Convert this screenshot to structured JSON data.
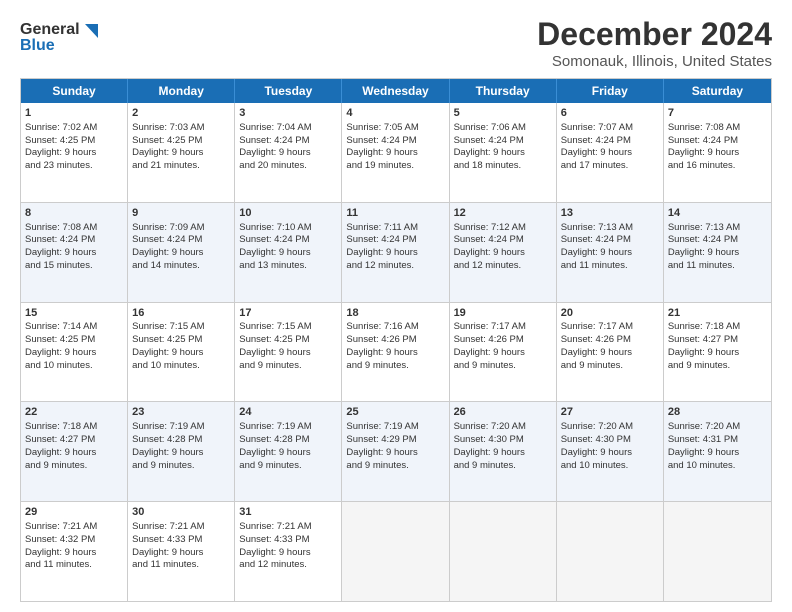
{
  "header": {
    "logo_general": "General",
    "logo_blue": "Blue",
    "title": "December 2024",
    "subtitle": "Somonauk, Illinois, United States"
  },
  "days_of_week": [
    "Sunday",
    "Monday",
    "Tuesday",
    "Wednesday",
    "Thursday",
    "Friday",
    "Saturday"
  ],
  "weeks": [
    [
      {
        "day": 1,
        "lines": [
          "Sunrise: 7:02 AM",
          "Sunset: 4:25 PM",
          "Daylight: 9 hours",
          "and 23 minutes."
        ],
        "shaded": false
      },
      {
        "day": 2,
        "lines": [
          "Sunrise: 7:03 AM",
          "Sunset: 4:25 PM",
          "Daylight: 9 hours",
          "and 21 minutes."
        ],
        "shaded": false
      },
      {
        "day": 3,
        "lines": [
          "Sunrise: 7:04 AM",
          "Sunset: 4:24 PM",
          "Daylight: 9 hours",
          "and 20 minutes."
        ],
        "shaded": false
      },
      {
        "day": 4,
        "lines": [
          "Sunrise: 7:05 AM",
          "Sunset: 4:24 PM",
          "Daylight: 9 hours",
          "and 19 minutes."
        ],
        "shaded": false
      },
      {
        "day": 5,
        "lines": [
          "Sunrise: 7:06 AM",
          "Sunset: 4:24 PM",
          "Daylight: 9 hours",
          "and 18 minutes."
        ],
        "shaded": false
      },
      {
        "day": 6,
        "lines": [
          "Sunrise: 7:07 AM",
          "Sunset: 4:24 PM",
          "Daylight: 9 hours",
          "and 17 minutes."
        ],
        "shaded": false
      },
      {
        "day": 7,
        "lines": [
          "Sunrise: 7:08 AM",
          "Sunset: 4:24 PM",
          "Daylight: 9 hours",
          "and 16 minutes."
        ],
        "shaded": false
      }
    ],
    [
      {
        "day": 8,
        "lines": [
          "Sunrise: 7:08 AM",
          "Sunset: 4:24 PM",
          "Daylight: 9 hours",
          "and 15 minutes."
        ],
        "shaded": true
      },
      {
        "day": 9,
        "lines": [
          "Sunrise: 7:09 AM",
          "Sunset: 4:24 PM",
          "Daylight: 9 hours",
          "and 14 minutes."
        ],
        "shaded": true
      },
      {
        "day": 10,
        "lines": [
          "Sunrise: 7:10 AM",
          "Sunset: 4:24 PM",
          "Daylight: 9 hours",
          "and 13 minutes."
        ],
        "shaded": true
      },
      {
        "day": 11,
        "lines": [
          "Sunrise: 7:11 AM",
          "Sunset: 4:24 PM",
          "Daylight: 9 hours",
          "and 12 minutes."
        ],
        "shaded": true
      },
      {
        "day": 12,
        "lines": [
          "Sunrise: 7:12 AM",
          "Sunset: 4:24 PM",
          "Daylight: 9 hours",
          "and 12 minutes."
        ],
        "shaded": true
      },
      {
        "day": 13,
        "lines": [
          "Sunrise: 7:13 AM",
          "Sunset: 4:24 PM",
          "Daylight: 9 hours",
          "and 11 minutes."
        ],
        "shaded": true
      },
      {
        "day": 14,
        "lines": [
          "Sunrise: 7:13 AM",
          "Sunset: 4:24 PM",
          "Daylight: 9 hours",
          "and 11 minutes."
        ],
        "shaded": true
      }
    ],
    [
      {
        "day": 15,
        "lines": [
          "Sunrise: 7:14 AM",
          "Sunset: 4:25 PM",
          "Daylight: 9 hours",
          "and 10 minutes."
        ],
        "shaded": false
      },
      {
        "day": 16,
        "lines": [
          "Sunrise: 7:15 AM",
          "Sunset: 4:25 PM",
          "Daylight: 9 hours",
          "and 10 minutes."
        ],
        "shaded": false
      },
      {
        "day": 17,
        "lines": [
          "Sunrise: 7:15 AM",
          "Sunset: 4:25 PM",
          "Daylight: 9 hours",
          "and 9 minutes."
        ],
        "shaded": false
      },
      {
        "day": 18,
        "lines": [
          "Sunrise: 7:16 AM",
          "Sunset: 4:26 PM",
          "Daylight: 9 hours",
          "and 9 minutes."
        ],
        "shaded": false
      },
      {
        "day": 19,
        "lines": [
          "Sunrise: 7:17 AM",
          "Sunset: 4:26 PM",
          "Daylight: 9 hours",
          "and 9 minutes."
        ],
        "shaded": false
      },
      {
        "day": 20,
        "lines": [
          "Sunrise: 7:17 AM",
          "Sunset: 4:26 PM",
          "Daylight: 9 hours",
          "and 9 minutes."
        ],
        "shaded": false
      },
      {
        "day": 21,
        "lines": [
          "Sunrise: 7:18 AM",
          "Sunset: 4:27 PM",
          "Daylight: 9 hours",
          "and 9 minutes."
        ],
        "shaded": false
      }
    ],
    [
      {
        "day": 22,
        "lines": [
          "Sunrise: 7:18 AM",
          "Sunset: 4:27 PM",
          "Daylight: 9 hours",
          "and 9 minutes."
        ],
        "shaded": true
      },
      {
        "day": 23,
        "lines": [
          "Sunrise: 7:19 AM",
          "Sunset: 4:28 PM",
          "Daylight: 9 hours",
          "and 9 minutes."
        ],
        "shaded": true
      },
      {
        "day": 24,
        "lines": [
          "Sunrise: 7:19 AM",
          "Sunset: 4:28 PM",
          "Daylight: 9 hours",
          "and 9 minutes."
        ],
        "shaded": true
      },
      {
        "day": 25,
        "lines": [
          "Sunrise: 7:19 AM",
          "Sunset: 4:29 PM",
          "Daylight: 9 hours",
          "and 9 minutes."
        ],
        "shaded": true
      },
      {
        "day": 26,
        "lines": [
          "Sunrise: 7:20 AM",
          "Sunset: 4:30 PM",
          "Daylight: 9 hours",
          "and 9 minutes."
        ],
        "shaded": true
      },
      {
        "day": 27,
        "lines": [
          "Sunrise: 7:20 AM",
          "Sunset: 4:30 PM",
          "Daylight: 9 hours",
          "and 10 minutes."
        ],
        "shaded": true
      },
      {
        "day": 28,
        "lines": [
          "Sunrise: 7:20 AM",
          "Sunset: 4:31 PM",
          "Daylight: 9 hours",
          "and 10 minutes."
        ],
        "shaded": true
      }
    ],
    [
      {
        "day": 29,
        "lines": [
          "Sunrise: 7:21 AM",
          "Sunset: 4:32 PM",
          "Daylight: 9 hours",
          "and 11 minutes."
        ],
        "shaded": false
      },
      {
        "day": 30,
        "lines": [
          "Sunrise: 7:21 AM",
          "Sunset: 4:33 PM",
          "Daylight: 9 hours",
          "and 11 minutes."
        ],
        "shaded": false
      },
      {
        "day": 31,
        "lines": [
          "Sunrise: 7:21 AM",
          "Sunset: 4:33 PM",
          "Daylight: 9 hours",
          "and 12 minutes."
        ],
        "shaded": false
      },
      {
        "day": null,
        "lines": [],
        "shaded": false,
        "empty": true
      },
      {
        "day": null,
        "lines": [],
        "shaded": false,
        "empty": true
      },
      {
        "day": null,
        "lines": [],
        "shaded": false,
        "empty": true
      },
      {
        "day": null,
        "lines": [],
        "shaded": false,
        "empty": true
      }
    ]
  ]
}
